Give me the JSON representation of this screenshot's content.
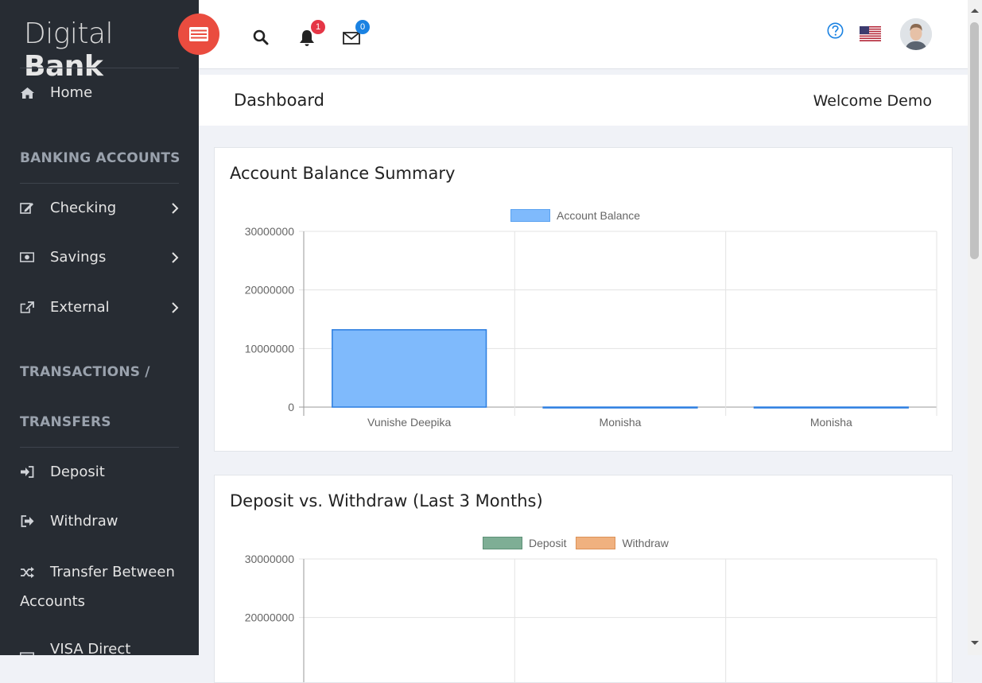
{
  "brand": {
    "light": "Digital",
    "bold": "Bank"
  },
  "sidebar": {
    "home": "Home",
    "section_banking": "BANKING ACCOUNTS",
    "checking": "Checking",
    "savings": "Savings",
    "external": "External",
    "section_trans_1": "TRANSACTIONS /",
    "section_trans_2": "TRANSFERS",
    "deposit": "Deposit",
    "withdraw": "Withdraw",
    "transfer_1": "Transfer Between",
    "transfer_2": "Accounts",
    "visa": "VISA Direct Transfer"
  },
  "header": {
    "notifications_count": "1",
    "messages_count": "0",
    "icons": [
      "search-icon",
      "bell-icon",
      "envelope-icon",
      "help-icon",
      "us-flag-icon",
      "avatar"
    ]
  },
  "titlebar": {
    "title": "Dashboard",
    "welcome": "Welcome Demo"
  },
  "colors": {
    "sidebar": "#272c33",
    "brand_button": "#ea4c3f",
    "balance_bar": "#7fbafc",
    "balance_border": "#2b7de0",
    "deposit": "#7eae95",
    "withdraw": "#f0b17f"
  },
  "chart_data": [
    {
      "type": "bar",
      "title": "Account Balance Summary",
      "categories": [
        "Vunishe Deepika",
        "Monisha",
        "Monisha"
      ],
      "series": [
        {
          "name": "Account Balance",
          "values": [
            13200000,
            0,
            0
          ]
        }
      ],
      "yticks": [
        "0",
        "10000000",
        "20000000",
        "30000000"
      ],
      "ylim": [
        0,
        30000000
      ],
      "grid": true,
      "legend": "top-center"
    },
    {
      "type": "bar",
      "title": "Deposit vs. Withdraw (Last 3 Months)",
      "series": [
        {
          "name": "Deposit",
          "values": []
        },
        {
          "name": "Withdraw",
          "values": []
        }
      ],
      "yticks": [
        "20000000",
        "30000000"
      ],
      "ylim": [
        0,
        30000000
      ],
      "grid": true,
      "legend": "top-center"
    }
  ]
}
